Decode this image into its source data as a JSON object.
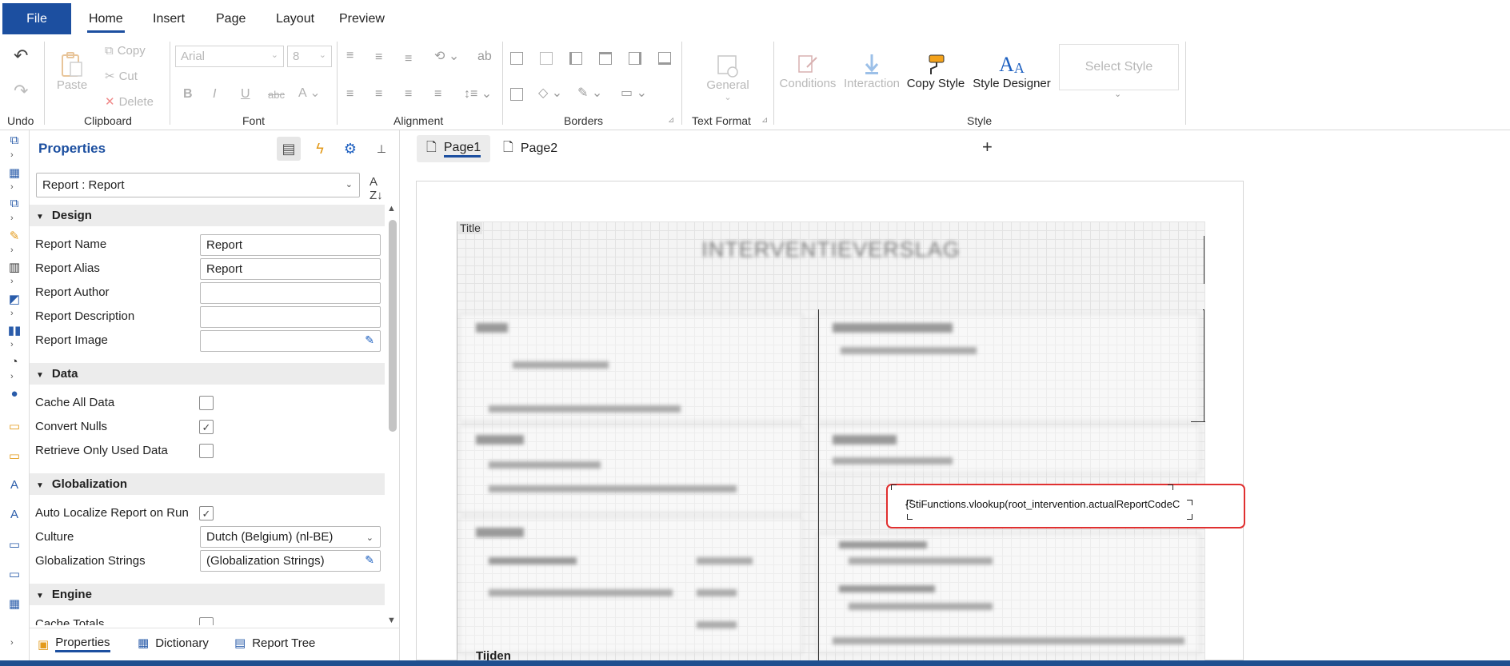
{
  "menu": {
    "file": "File",
    "tabs": [
      "Home",
      "Insert",
      "Page",
      "Layout",
      "Preview"
    ],
    "active_tab": "Home"
  },
  "ribbon": {
    "undo": {
      "label": "Undo"
    },
    "clipboard": {
      "label": "Clipboard",
      "paste": "Paste",
      "copy": "Copy",
      "cut": "Cut",
      "delete": "Delete"
    },
    "font": {
      "label": "Font",
      "family": "Arial",
      "size": "8"
    },
    "alignment": {
      "label": "Alignment"
    },
    "borders": {
      "label": "Borders"
    },
    "text_format": {
      "label": "Text Format",
      "general": "General"
    },
    "style": {
      "label": "Style",
      "conditions": "Conditions",
      "interaction": "Interaction",
      "copy_style": "Copy Style",
      "style_designer": "Style Designer",
      "select_style": "Select Style"
    }
  },
  "properties": {
    "title": "Properties",
    "object": "Report : Report",
    "categories": {
      "design": "Design",
      "data": "Data",
      "globalization": "Globalization",
      "engine": "Engine"
    },
    "design": {
      "report_name_label": "Report Name",
      "report_name": "Report",
      "report_alias_label": "Report Alias",
      "report_alias": "Report",
      "report_author_label": "Report Author",
      "report_author": "",
      "report_description_label": "Report Description",
      "report_description": "",
      "report_image_label": "Report Image",
      "report_image": ""
    },
    "data": {
      "cache_all_label": "Cache All Data",
      "cache_all": false,
      "convert_nulls_label": "Convert Nulls",
      "convert_nulls": true,
      "retrieve_only_label": "Retrieve Only Used Data",
      "retrieve_only": false
    },
    "globalization": {
      "auto_localize_label": "Auto Localize Report on Run",
      "auto_localize": true,
      "culture_label": "Culture",
      "culture": "Dutch (Belgium)  (nl-BE)",
      "strings_label": "Globalization Strings",
      "strings": "(Globalization Strings)"
    },
    "engine": {
      "cache_totals_label": "Cache Totals",
      "cache_totals": false
    },
    "bottom_tabs": [
      "Properties",
      "Dictionary",
      "Report Tree"
    ]
  },
  "pages": {
    "tabs": [
      "Page1",
      "Page2"
    ],
    "active": "Page1"
  },
  "report": {
    "band_label": "Title",
    "heading": "INTERVENTIEVERSLAG",
    "selected_expression": "{StiFunctions.vlookup(root_intervention.actualReportCodeC",
    "tijden": "Tijden"
  }
}
